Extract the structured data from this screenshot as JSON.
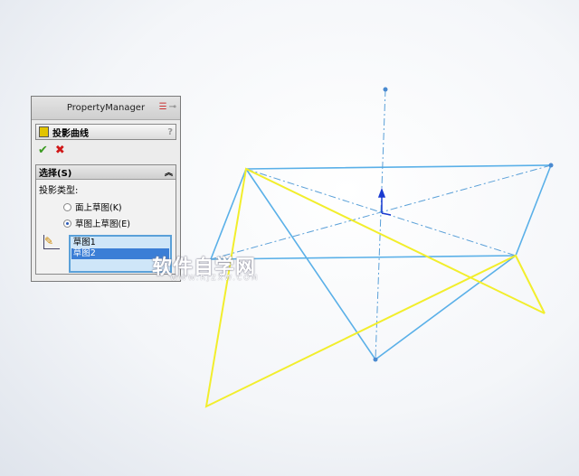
{
  "property_manager": {
    "title": "PropertyManager",
    "header_icons": [
      "split-icon",
      "pin-icon"
    ],
    "feature_name": "投影曲线",
    "help": "?",
    "ok_icon": "check-icon",
    "cancel_icon": "close-icon",
    "group": {
      "title": "选择(S)",
      "collapse_icon": "double-chevron-up-icon",
      "type_label": "投影类型:",
      "options": [
        {
          "label": "面上草图(K)",
          "selected": false
        },
        {
          "label": "草图上草图(E)",
          "selected": true
        }
      ],
      "selection_items": [
        "草图1",
        "草图2"
      ],
      "selected_index": 1
    }
  },
  "watermark": {
    "text": "软件自学网",
    "url": "WWW.RJZXW.COM"
  },
  "colors": {
    "blue_lines": "#5ab0e8",
    "yellow_lines": "#f2ee2c",
    "axis": "#5aa0d8"
  }
}
